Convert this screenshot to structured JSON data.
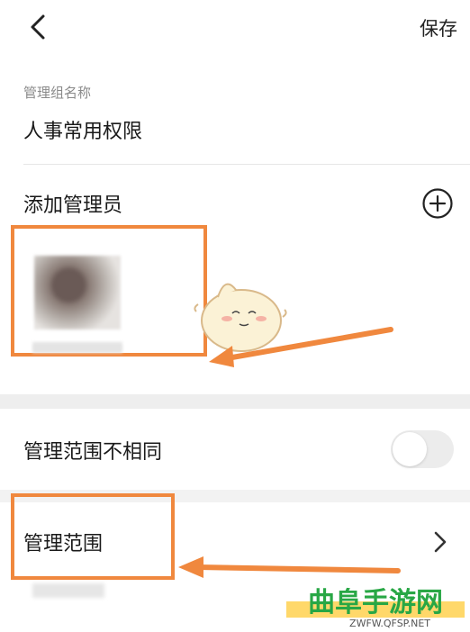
{
  "header": {
    "back_icon": "chevron-left-icon",
    "save_label": "保存"
  },
  "group_name": {
    "label": "管理组名称",
    "value": "人事常用权限"
  },
  "admins": {
    "label": "添加管理员",
    "add_icon": "plus-circle-icon"
  },
  "scope_diff": {
    "label": "管理范围不相同",
    "toggle_on": false
  },
  "scope": {
    "label": "管理范围",
    "chevron_icon": "chevron-right-icon"
  },
  "watermark": {
    "title": "曲阜手游网",
    "subtitle": "ZWFW.QFSP.NET"
  },
  "colors": {
    "annotation_orange": "#f0883e",
    "watermark_green": "#28a745",
    "watermark_yellow": "#ffd86a"
  }
}
